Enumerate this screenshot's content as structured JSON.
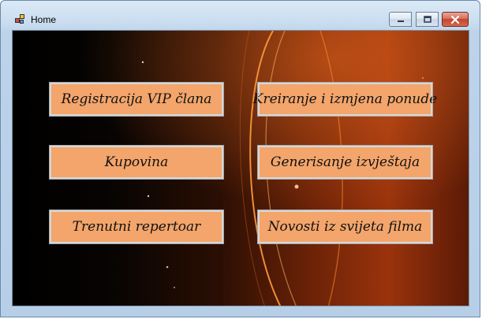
{
  "window": {
    "title": "Home",
    "controls": {
      "minimize_icon": "minimize-icon",
      "maximize_icon": "maximize-icon",
      "close_icon": "close-icon"
    }
  },
  "menu_buttons": [
    {
      "label": "Registracija VIP člana"
    },
    {
      "label": "Kreiranje i izmjena ponude"
    },
    {
      "label": "Kupovina"
    },
    {
      "label": "Generisanje izvještaja"
    },
    {
      "label": "Trenutni repertoar"
    },
    {
      "label": "Novosti iz svijeta filma"
    }
  ],
  "colors": {
    "button_fill": "#f3a56b",
    "button_border": "#d7d7d7",
    "background_dark": "#000000",
    "background_accent": "#c2410c"
  }
}
